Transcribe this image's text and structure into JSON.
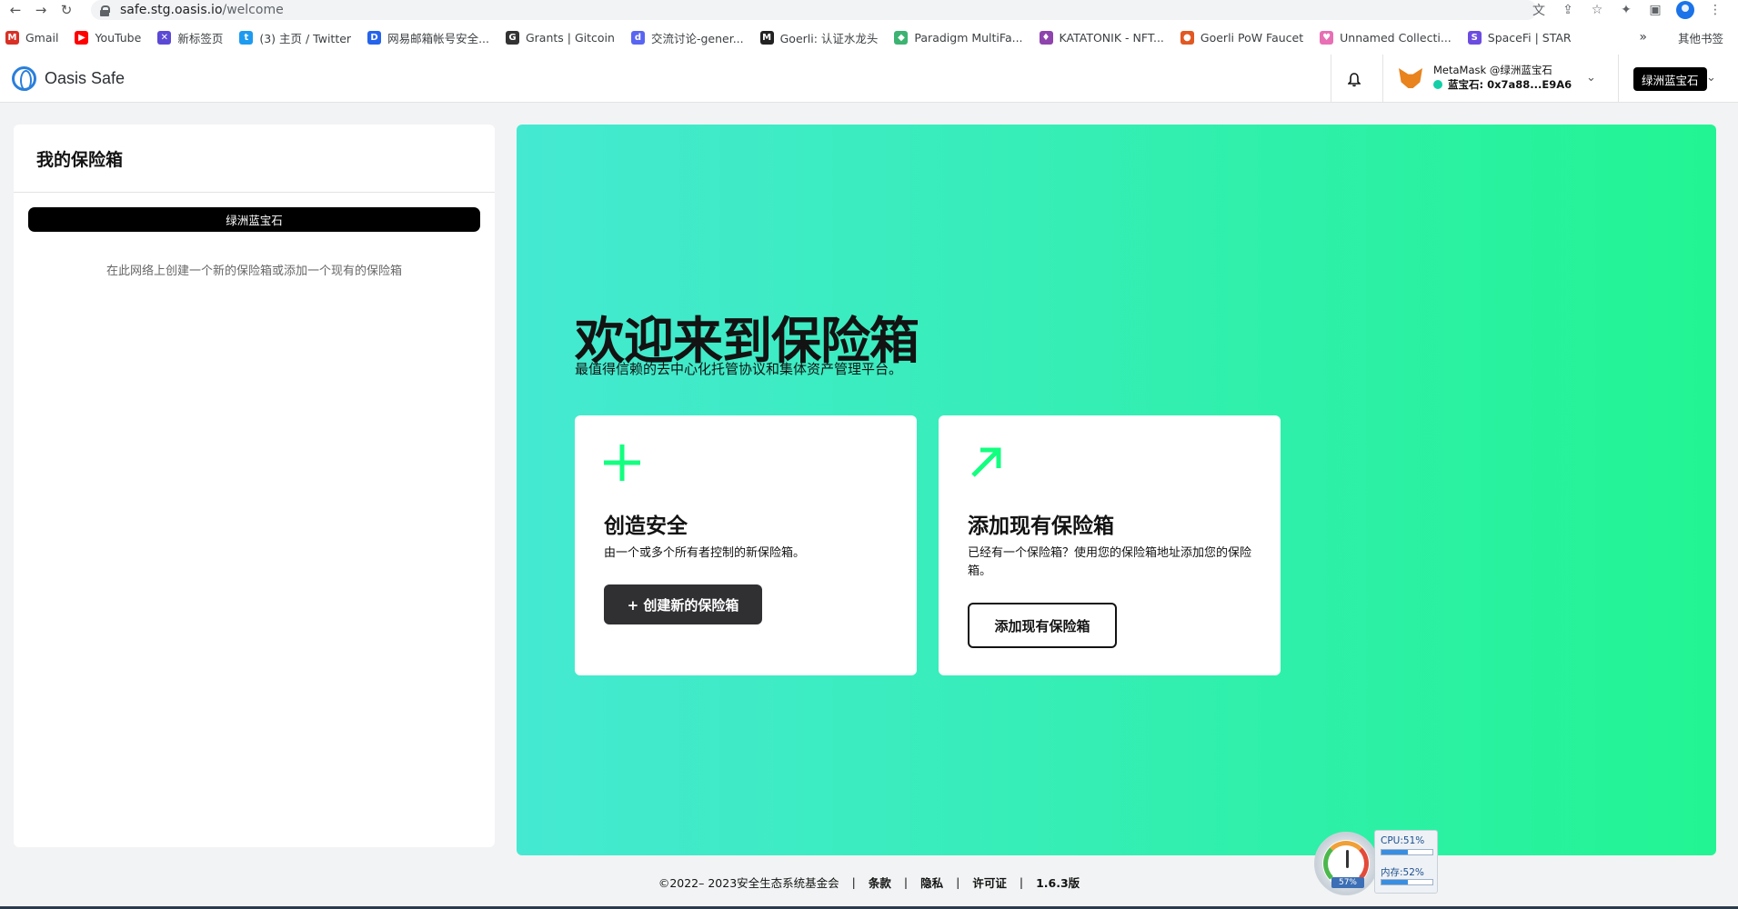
{
  "browser": {
    "url_host": "safe.stg.oasis.io",
    "url_path": "/welcome",
    "bookmarks": [
      {
        "label": "Gmail",
        "color": "#d93025",
        "glyph": "M"
      },
      {
        "label": "YouTube",
        "color": "#ff0000",
        "glyph": "▶"
      },
      {
        "label": "新标签页",
        "color": "#5b49d6",
        "glyph": "✕"
      },
      {
        "label": "(3) 主页 / Twitter",
        "color": "#1d9bf0",
        "glyph": "t"
      },
      {
        "label": "网易邮箱帐号安全...",
        "color": "#2563eb",
        "glyph": "D"
      },
      {
        "label": "Grants | Gitcoin",
        "color": "#333333",
        "glyph": "G"
      },
      {
        "label": "交流讨论-gener...",
        "color": "#5865f2",
        "glyph": "d"
      },
      {
        "label": "Goerli: 认证水龙头",
        "color": "#222222",
        "glyph": "M"
      },
      {
        "label": "Paradigm MultiFa...",
        "color": "#3cb371",
        "glyph": "◆"
      },
      {
        "label": "KATATONIK - NFT...",
        "color": "#8e44ad",
        "glyph": "♦"
      },
      {
        "label": "Goerli PoW Faucet",
        "color": "#e25822",
        "glyph": "●"
      },
      {
        "label": "Unnamed Collecti...",
        "color": "#e86fb4",
        "glyph": "♥"
      },
      {
        "label": "SpaceFi | STAR",
        "color": "#6c4ce0",
        "glyph": "S"
      }
    ],
    "bookmarks_more": "»",
    "other_bookmarks": "其他书签"
  },
  "header": {
    "logo_text": "Oasis Safe",
    "wallet_name": "MetaMask @绿洲蓝宝石",
    "wallet_address": "蓝宝石: 0x7a88...E9A6",
    "network_badge": "绿洲蓝宝石"
  },
  "sidebar": {
    "title": "我的保险箱",
    "network_label": "绿洲蓝宝石",
    "hint": "在此网络上创建一个新的保险箱或添加一个现有的保险箱"
  },
  "hero": {
    "title": "欢迎来到保险箱",
    "subtitle": "最值得信赖的去中心化托管协议和集体资产管理平台。",
    "cards": [
      {
        "title": "创造安全",
        "description": "由一个或多个所有者控制的新保险箱。",
        "button": "+ 创建新的保险箱"
      },
      {
        "title": "添加现有保险箱",
        "description": "已经有一个保险箱？使用您的保险箱地址添加您的保险箱。",
        "button": "添加现有保险箱"
      }
    ],
    "accent_color": "#12ff80"
  },
  "footer": {
    "copyright": "©2022– 2023安全生态系统基金会",
    "terms": "条款",
    "privacy": "隐私",
    "licenses": "许可证",
    "version": "1.6.3版"
  },
  "monitor": {
    "gauge_value": "57%",
    "cpu_label": "CPU:51%",
    "cpu_fraction": 0.51,
    "mem_label": "内存:52%",
    "mem_fraction": 0.52
  }
}
